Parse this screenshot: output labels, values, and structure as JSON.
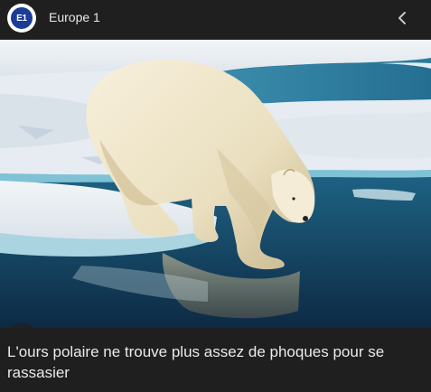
{
  "header": {
    "logo_text": "E1",
    "source_name": "Europe 1"
  },
  "image": {
    "subject": "polar-bear-on-ice-floe"
  },
  "caption": "L'ours polaire ne trouve plus assez de phoques pour se rassasier",
  "icons": {
    "back": "chevron-left-icon",
    "lens": "lens-search-icon"
  },
  "colors": {
    "background": "#1f1f1f",
    "text": "#e8eaed",
    "logo_blue": "#1b3c97"
  }
}
